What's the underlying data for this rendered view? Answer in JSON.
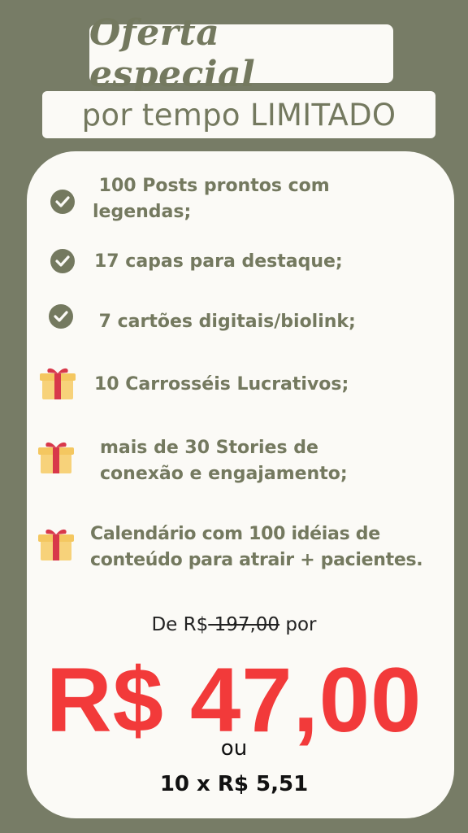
{
  "header": {
    "title": "Oferta especial",
    "subtitle": "por tempo LIMITADO"
  },
  "items": [
    {
      "icon": "check-circle-icon",
      "line1": " 100 Posts prontos com",
      "line2": "legendas;"
    },
    {
      "icon": "check-circle-icon",
      "line1": "17 capas para destaque;"
    },
    {
      "icon": "check-circle-icon",
      "line1": " 7 cartões digitais/biolink;"
    },
    {
      "icon": "gift-icon",
      "line1": "10 Carrosséis Lucrativos;"
    },
    {
      "icon": "gift-icon",
      "line1": "mais de 30 Stories de",
      "line2": "conexão e engajamento;"
    },
    {
      "icon": "gift-icon",
      "line1": "Calendário com 100 idéias de",
      "line2": "conteúdo para atrair + pacientes."
    }
  ],
  "pricing": {
    "from_prefix": "De R$",
    "old_price": " 197,00",
    "from_suffix": " por",
    "price": "R$ 47,00",
    "or": "ou",
    "installments": "10 x R$ 5,51"
  },
  "colors": {
    "background": "#777c66",
    "card": "#fbfaf6",
    "text": "#74795f",
    "price": "#f23a3a",
    "gift_box": "#f7d27a",
    "gift_ribbon": "#d8384a"
  }
}
